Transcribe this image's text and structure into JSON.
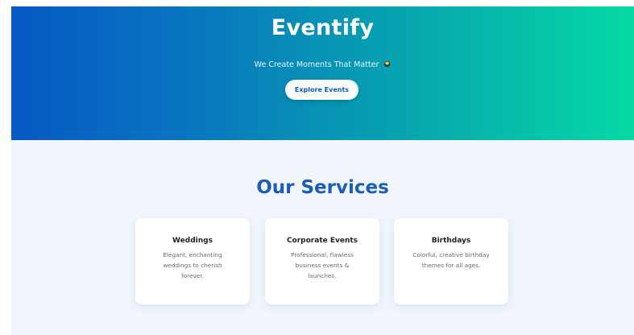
{
  "hero": {
    "title": "Eventify",
    "tagline": "We Create Moments That Matter",
    "tagline_emoji_icon": "sparkle-emoji-icon",
    "cta_label": "Explore Events",
    "gradient_colors": [
      "#0759c4",
      "#06d9a4"
    ]
  },
  "services": {
    "heading": "Our Services",
    "heading_color": "#1d5db5",
    "background": "#f1f6fd",
    "items": [
      {
        "title": "Weddings",
        "description": "Elegant, enchanting weddings to cherish forever."
      },
      {
        "title": "Corporate Events",
        "description": "Professional, flawless business events & launches."
      },
      {
        "title": "Birthdays",
        "description": "Colorful, creative birthday themes for all ages."
      }
    ]
  }
}
